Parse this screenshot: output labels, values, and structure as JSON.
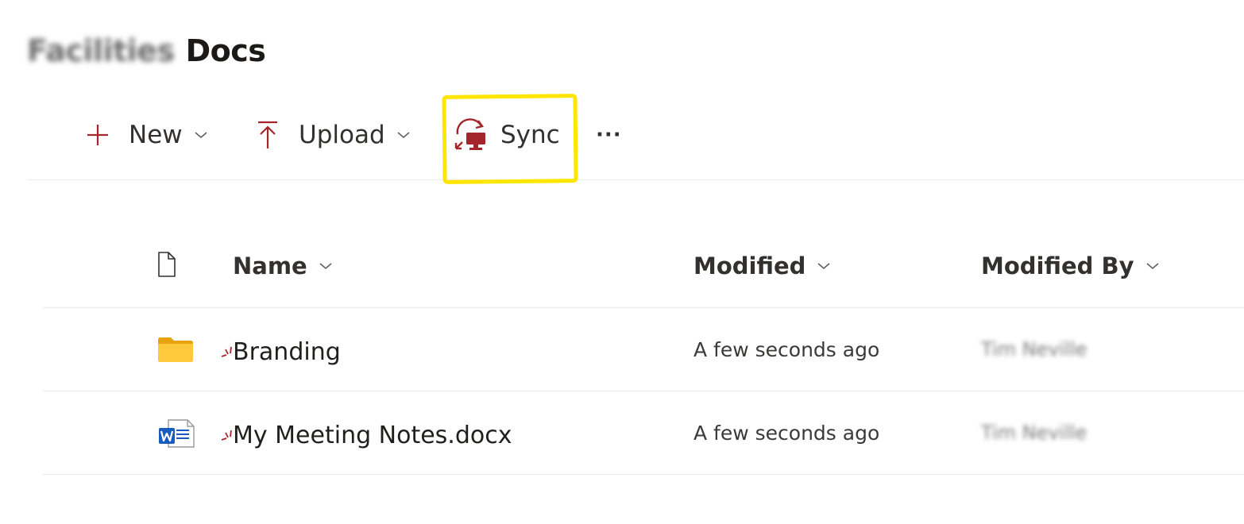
{
  "library": {
    "title_prefix": "Facilities",
    "title_main": "Docs"
  },
  "commandbar": {
    "new_label": "New",
    "upload_label": "Upload",
    "sync_label": "Sync",
    "more_label": "···"
  },
  "list": {
    "columns": {
      "name": "Name",
      "modified": "Modified",
      "modified_by": "Modified By"
    },
    "rows": [
      {
        "type": "folder",
        "name": "Branding",
        "modified": "A few seconds ago",
        "modified_by": "Tim Neville"
      },
      {
        "type": "word-document",
        "name": "My Meeting Notes.docx",
        "modified": "A few seconds ago",
        "modified_by": "Tim Neville"
      }
    ]
  },
  "colors": {
    "accent": "#a4262c",
    "highlight": "#ffe600",
    "folder": "#ffc83d",
    "word": "#185abd"
  },
  "icons": [
    "plus-icon",
    "upload-icon",
    "sync-icon",
    "more-icon",
    "file-type-icon",
    "folder-icon",
    "word-file-icon",
    "new-item-icon",
    "chevron-down-icon"
  ]
}
